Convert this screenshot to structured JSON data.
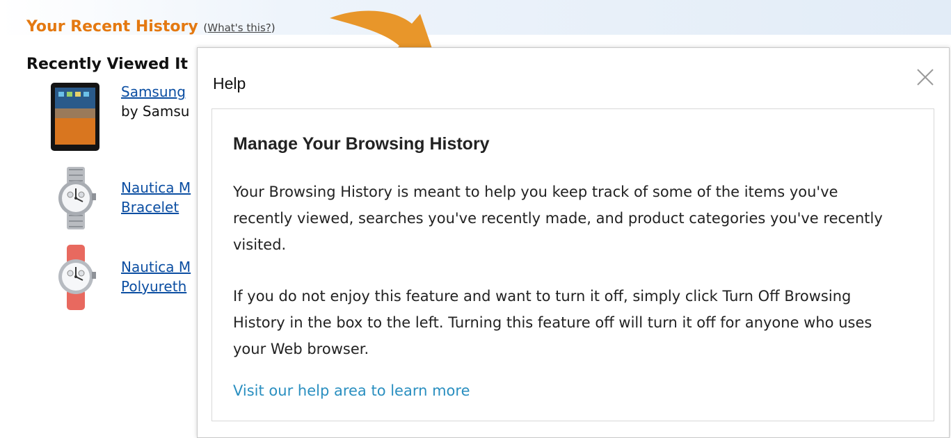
{
  "section": {
    "title": "Your Recent History",
    "whats_this_open": "(",
    "whats_this": "What's this?",
    "whats_this_close": ")"
  },
  "recently_viewed": {
    "title": "Recently Viewed It",
    "items": [
      {
        "name": "Samsung",
        "by": "by Samsu"
      },
      {
        "name": "Nautica M",
        "line2": "Bracelet"
      },
      {
        "name": "Nautica M",
        "line2": "Polyureth"
      }
    ]
  },
  "popover": {
    "title": "Help",
    "heading": "Manage Your Browsing History",
    "paragraph1": "Your Browsing History is meant to help you keep track of some of the items you've recently viewed, searches you've recently made, and product categories you've recently visited.",
    "paragraph2": "If you do not enjoy this feature and want to turn it off, simply click Turn Off Browsing History in the box to the left. Turning this feature off will turn it off for anyone who uses your Web browser.",
    "link": "Visit our help area to learn more"
  },
  "colors": {
    "accent_orange": "#e47911",
    "link_blue": "#0b4ea2",
    "help_link": "#2a8fc0",
    "arrow": "#e8962a"
  }
}
